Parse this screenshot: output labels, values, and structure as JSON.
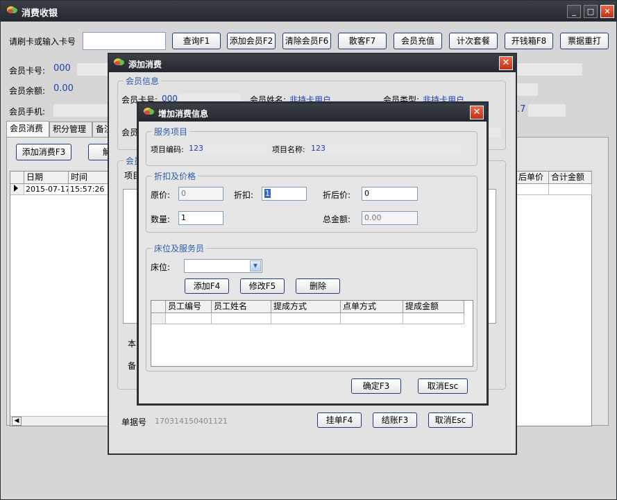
{
  "window": {
    "title": "消费收银",
    "min_icon": "minimize-icon",
    "max_icon": "maximize-icon",
    "close_icon": "close-icon"
  },
  "toolbar": {
    "card_label": "请刷卡或输入卡号",
    "card_value": "",
    "buttons": [
      "查询F1",
      "添加会员F2",
      "清除会员F6",
      "散客F7",
      "会员充值",
      "计次套餐",
      "开钱箱F8",
      "票据重打"
    ]
  },
  "member": {
    "card_no_label": "会员卡号:",
    "card_no": "000",
    "balance_label": "会员余额:",
    "balance": "0.00",
    "phone_label": "会员手机:",
    "right_value": ".7"
  },
  "tabs": [
    "会员消费",
    "积分管理",
    "备注"
  ],
  "main": {
    "add_button": "添加消费F3",
    "partial_button": "解",
    "grid_headers": [
      "日期",
      "时间"
    ],
    "grid_right_headers": [
      "后单价",
      "合计金额"
    ],
    "row": {
      "date": "2015-07-17",
      "time": "15:57:26"
    }
  },
  "add_dialog": {
    "title": "添加消费",
    "member_group": "会员信息",
    "card_no_label": "会员卡号:",
    "card_no": "000",
    "name_label": "会员姓名:",
    "name": "非持卡用户",
    "type_label": "会员类型:",
    "type": "非持卡用户",
    "partial_label": "会员",
    "section_label": "会员",
    "item_label": "项目",
    "ben_label": "本",
    "bei_label": "备",
    "order_label": "单据号",
    "order_no": "170314150401121",
    "buttons": [
      "挂单F4",
      "结账F3",
      "取消Esc"
    ]
  },
  "info_dialog": {
    "title": "增加消费信息",
    "service_group": "服务项目",
    "code_label": "项目编码:",
    "code": "123",
    "item_name_label": "项目名称:",
    "item_name": "123",
    "price_group": "折扣及价格",
    "orig_price_label": "原价:",
    "orig_price": "0",
    "discount_label": "折扣:",
    "discount": "1",
    "after_price_label": "折后价:",
    "after_price": "0",
    "qty_label": "数量:",
    "qty": "1",
    "total_label": "总金额:",
    "total": "0.00",
    "bed_group": "床位及服务员",
    "bed_label": "床位:",
    "bed_value": "",
    "staff_buttons": [
      "添加F4",
      "修改F5",
      "删除"
    ],
    "staff_headers": [
      "员工编号",
      "员工姓名",
      "提成方式",
      "点单方式",
      "提成金额"
    ],
    "ok_button": "确定F3",
    "cancel_button": "取消Esc"
  },
  "colors": {
    "title_bar": "#24282e",
    "accent_blue": "#1b3fb0",
    "group_title": "#2d5caa",
    "close_red": "#c0301a"
  }
}
